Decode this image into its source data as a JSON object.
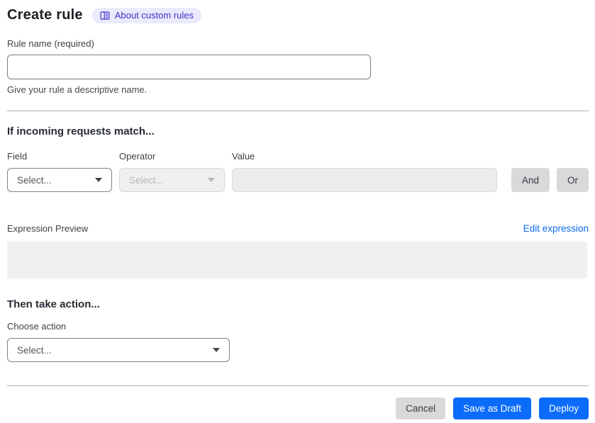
{
  "page": {
    "title": "Create rule",
    "about_badge_label": "About custom rules"
  },
  "rule_name": {
    "label": "Rule name (required)",
    "value": "",
    "helper": "Give your rule a descriptive name."
  },
  "match_section": {
    "heading": "If incoming requests match...",
    "field": {
      "label": "Field",
      "selected": "Select..."
    },
    "operator": {
      "label": "Operator",
      "selected": "Select..."
    },
    "value": {
      "label": "Value",
      "value": ""
    },
    "and_button": "And",
    "or_button": "Or"
  },
  "expression": {
    "label": "Expression Preview",
    "edit_link": "Edit expression",
    "preview_text": ""
  },
  "action_section": {
    "heading": "Then take action...",
    "choose_action": {
      "label": "Choose action",
      "selected": "Select..."
    }
  },
  "footer": {
    "cancel": "Cancel",
    "save_draft": "Save as Draft",
    "deploy": "Deploy"
  },
  "colors": {
    "primary_blue": "#0b6cfa",
    "link_blue": "#0d6ced",
    "badge_bg": "#ebe9fc",
    "badge_text": "#3b33c8",
    "chip_gray": "#d9d9d9",
    "disabled_bg": "#f0f0f0",
    "preview_bg": "#f0f0f1",
    "divider": "#aeaeae"
  }
}
